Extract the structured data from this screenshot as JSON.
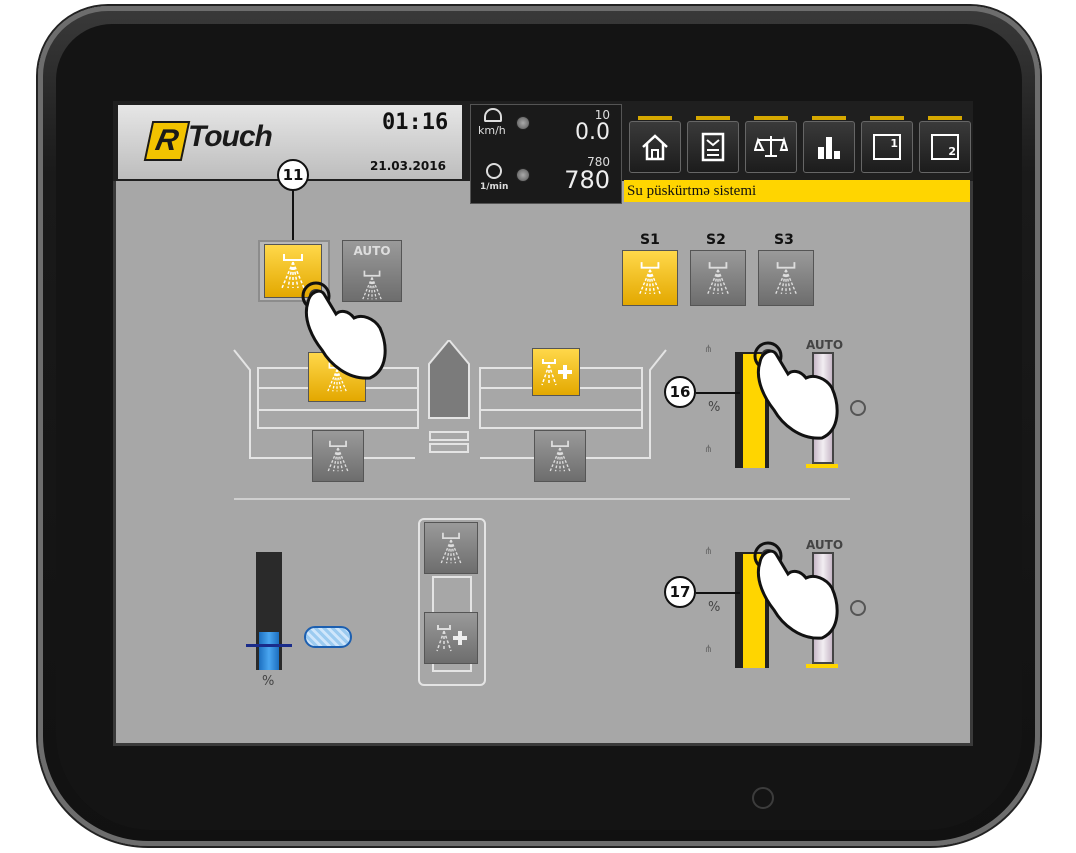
{
  "header": {
    "brand_r": "R",
    "brand_text": "Touch",
    "time": "01:16",
    "date": "21.03.2016"
  },
  "gauges": {
    "speed_unit": "km/h",
    "speed_max": "10",
    "speed_value": "0.0",
    "rpm_unit": "1/min",
    "rpm_max": "780",
    "rpm_value": "780"
  },
  "nav": {
    "items": [
      "home-icon",
      "menu-icon",
      "scale-icon",
      "stats-icon",
      "screen-1-icon",
      "screen-2-icon"
    ],
    "screen1": "1",
    "screen2": "2"
  },
  "screen_title": "Su püskürtmə sistemi",
  "controls": {
    "auto_label": "AUTO",
    "sections": [
      "S1",
      "S2",
      "S3"
    ],
    "percent": "%",
    "tank_percent": "%"
  },
  "callouts": {
    "c11": "11",
    "c16": "16",
    "c17": "17"
  },
  "states": {
    "upper_bar_level": 0.98,
    "lower_bar_level": 0.98,
    "tank_level": 0.32
  },
  "colors": {
    "accent": "#ffd500",
    "screen_bg": "#a7a7a7",
    "tank_blue": "#2f8fe0"
  }
}
